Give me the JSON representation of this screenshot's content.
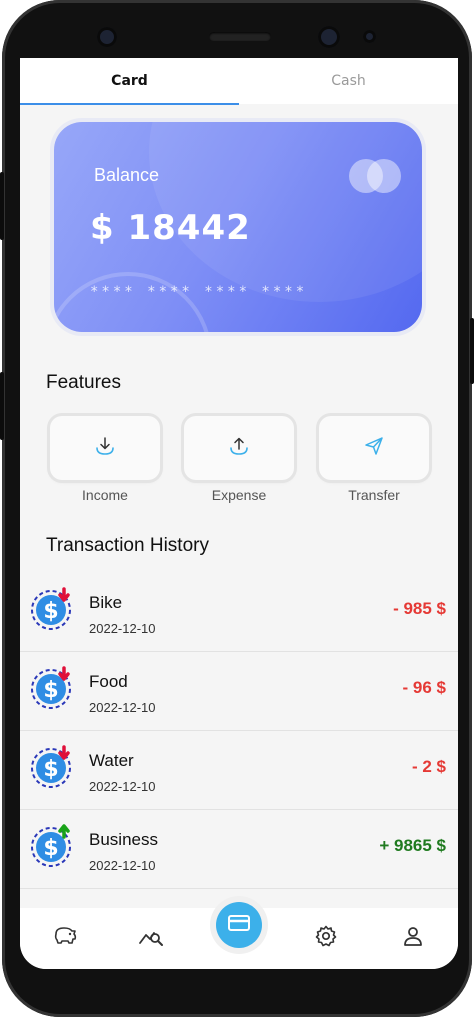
{
  "tabs": [
    {
      "label": "Card"
    },
    {
      "label": "Cash"
    }
  ],
  "card": {
    "label": "Balance",
    "amount": "$ 18442",
    "number": "**** **** **** ****"
  },
  "features": {
    "title": "Features",
    "items": [
      {
        "label": "Income",
        "icon": "download-arrow-icon"
      },
      {
        "label": "Expense",
        "icon": "upload-arrow-icon"
      },
      {
        "label": "Transfer",
        "icon": "send-icon"
      }
    ]
  },
  "history": {
    "title": "Transaction History",
    "items": [
      {
        "name": "Bike",
        "date": "2022-12-10",
        "amount": "- 985 $",
        "type": "expense"
      },
      {
        "name": "Food",
        "date": "2022-12-10",
        "amount": "- 96 $",
        "type": "expense"
      },
      {
        "name": "Water",
        "date": "2022-12-10",
        "amount": "- 2 $",
        "type": "expense"
      },
      {
        "name": "Business",
        "date": "2022-12-10",
        "amount": "+ 9865 $",
        "type": "income"
      }
    ]
  },
  "colors": {
    "expense": "#e53935",
    "income": "#1f7a1f",
    "accent": "#3b8ee8",
    "card_start": "#97a7f8",
    "card_end": "#5469f0"
  },
  "navbar": [
    {
      "icon": "piggy-bank-icon"
    },
    {
      "icon": "chart-search-icon"
    },
    {
      "icon": "card-icon"
    },
    {
      "icon": "gear-icon"
    },
    {
      "icon": "user-icon"
    }
  ]
}
